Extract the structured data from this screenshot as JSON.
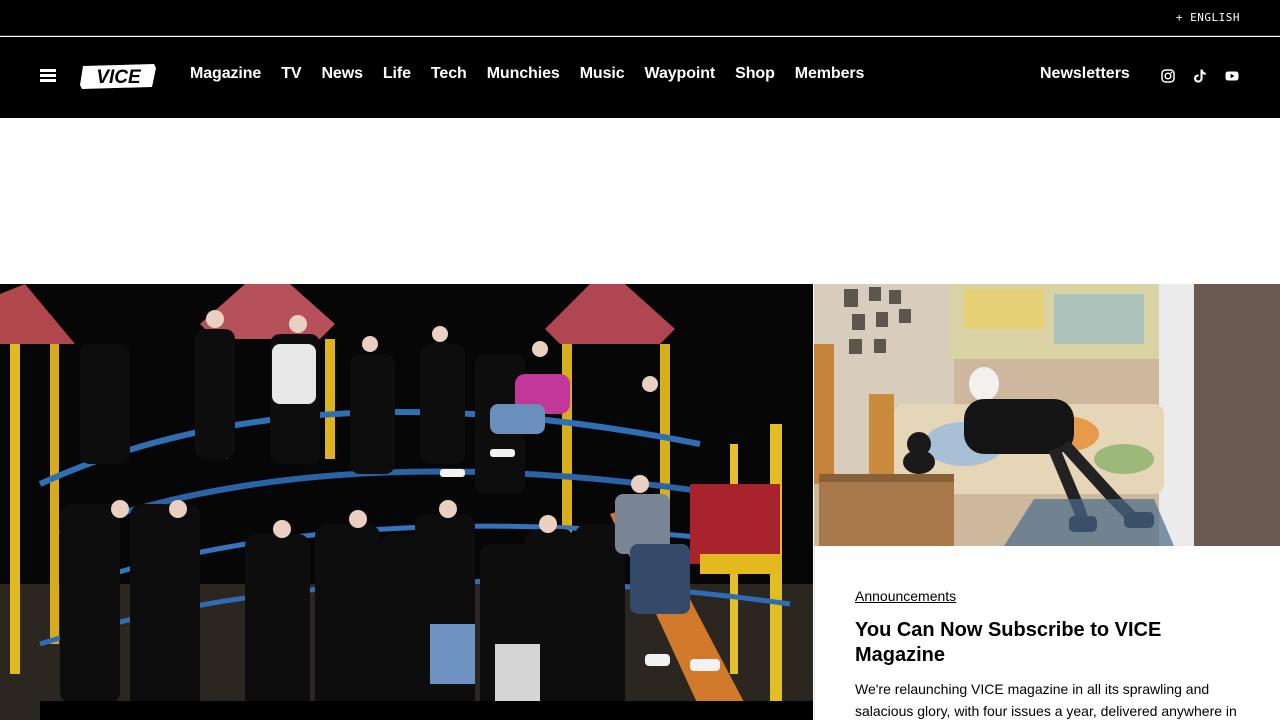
{
  "utility": {
    "language_label": "+ ENGLISH"
  },
  "nav": {
    "logo_text": "VICE",
    "links": [
      "Magazine",
      "TV",
      "News",
      "Life",
      "Tech",
      "Munchies",
      "Music",
      "Waypoint",
      "Shop",
      "Members"
    ],
    "newsletters_label": "Newsletters",
    "social_icons": [
      "instagram-icon",
      "tiktok-icon",
      "youtube-icon"
    ]
  },
  "feature": {
    "category": "Announcements",
    "headline": "You Can Now Subscribe to VICE Magazine",
    "dek": "We're relaunching VICE magazine in all its sprawling and salacious glory, with four issues a year, delivered anywhere in"
  },
  "colors": {
    "nav_bg": "#000000",
    "text_light": "#ffffff",
    "page_bg": "#ffffff"
  }
}
